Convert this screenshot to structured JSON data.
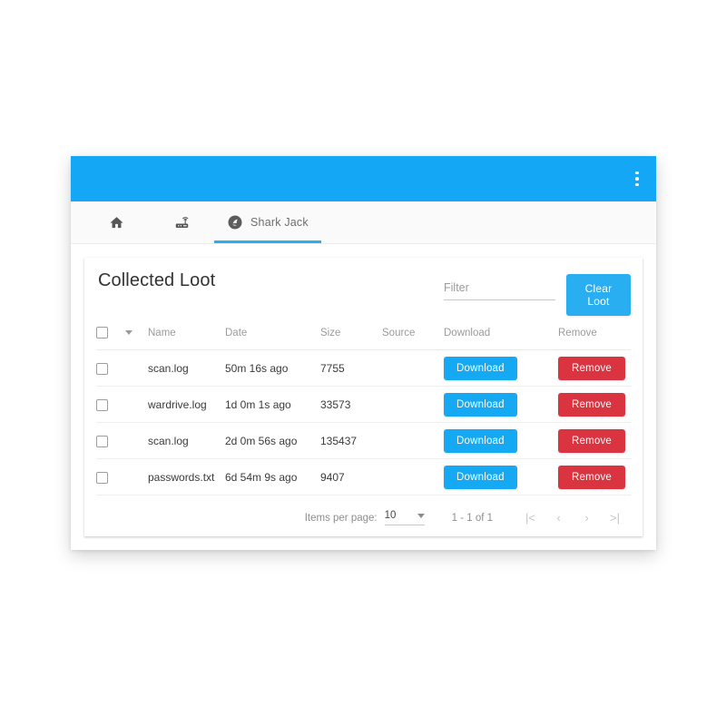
{
  "appbar": {
    "menu_icon": "kebab-menu-icon",
    "color": "#13A7F5"
  },
  "tabs": [
    {
      "id": "home",
      "icon": "home-icon",
      "label": ""
    },
    {
      "id": "network",
      "icon": "router-icon",
      "label": ""
    },
    {
      "id": "shark-jack",
      "icon": "shark-jack-icon",
      "label": "Shark Jack",
      "active": true
    }
  ],
  "card": {
    "title": "Collected Loot",
    "filter": {
      "placeholder": "Filter",
      "value": ""
    },
    "clear_button": "Clear Loot"
  },
  "table": {
    "headers": [
      "",
      "",
      "Name",
      "Date",
      "Size",
      "Source",
      "Download",
      "Remove"
    ],
    "rows": [
      {
        "checked": false,
        "name": "scan.log",
        "date": "50m 16s ago",
        "size": "7755",
        "source": "",
        "download_label": "Download",
        "remove_label": "Remove"
      },
      {
        "checked": false,
        "name": "wardrive.log",
        "date": "1d 0m 1s ago",
        "size": "33573",
        "source": "",
        "download_label": "Download",
        "remove_label": "Remove"
      },
      {
        "checked": false,
        "name": "scan.log",
        "date": "2d 0m 56s ago",
        "size": "135437",
        "source": "",
        "download_label": "Download",
        "remove_label": "Remove"
      },
      {
        "checked": false,
        "name": "passwords.txt",
        "date": "6d 54m 9s ago",
        "size": "9407",
        "source": "",
        "download_label": "Download",
        "remove_label": "Remove"
      }
    ]
  },
  "paginator": {
    "items_per_page_label": "Items per page:",
    "items_per_page_value": "10",
    "range_label": "1 - 1 of 1",
    "first_page_icon": "|<",
    "prev_page_icon": "‹",
    "next_page_icon": "›",
    "last_page_icon": ">|"
  },
  "colors": {
    "accent_blue": "#13A7F5",
    "button_blue": "#16A9F3",
    "danger_red": "#D9343F",
    "tabbar_bg": "#FAFAFA"
  }
}
